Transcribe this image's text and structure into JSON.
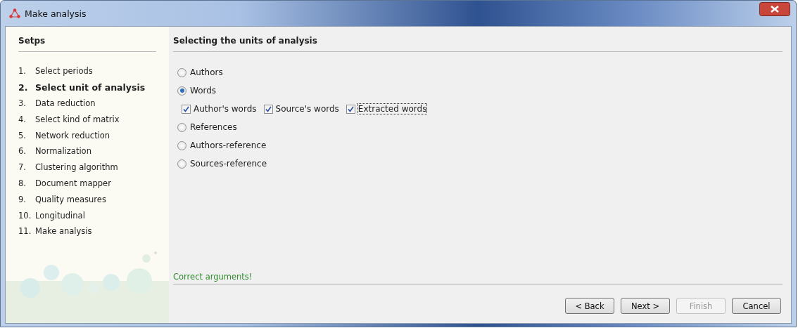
{
  "window": {
    "title": "Make analysis"
  },
  "steps": {
    "title": "Setps",
    "items": [
      {
        "number": "1.",
        "label": "Select periods",
        "selected": false
      },
      {
        "number": "2.",
        "label": "Select unit of analysis",
        "selected": true
      },
      {
        "number": "3.",
        "label": "Data reduction",
        "selected": false
      },
      {
        "number": "4.",
        "label": "Select kind of matrix",
        "selected": false
      },
      {
        "number": "5.",
        "label": "Network reduction",
        "selected": false
      },
      {
        "number": "6.",
        "label": "Normalization",
        "selected": false
      },
      {
        "number": "7.",
        "label": "Clustering algorithm",
        "selected": false
      },
      {
        "number": "8.",
        "label": "Document mapper",
        "selected": false
      },
      {
        "number": "9.",
        "label": "Quality measures",
        "selected": false
      },
      {
        "number": "10.",
        "label": "Longitudinal",
        "selected": false
      },
      {
        "number": "11.",
        "label": "Make analysis",
        "selected": false
      }
    ]
  },
  "panel": {
    "title": "Selecting the units of analysis",
    "options": [
      {
        "kind": "radio",
        "label": "Authors",
        "selected": false
      },
      {
        "kind": "radio",
        "label": "Words",
        "selected": true
      },
      {
        "kind": "checks",
        "items": [
          {
            "label": "Author's words",
            "checked": true,
            "focused": false
          },
          {
            "label": "Source's words",
            "checked": true,
            "focused": false
          },
          {
            "label": "Extracted words",
            "checked": true,
            "focused": true
          }
        ]
      },
      {
        "kind": "radio",
        "label": "References",
        "selected": false
      },
      {
        "kind": "radio",
        "label": "Authors-reference",
        "selected": false
      },
      {
        "kind": "radio",
        "label": "Sources-reference",
        "selected": false
      }
    ]
  },
  "status": "Correct arguments!",
  "buttons": [
    {
      "label": "< Back",
      "disabled": false
    },
    {
      "label": "Next >",
      "disabled": false
    },
    {
      "label": "Finish",
      "disabled": true
    },
    {
      "label": "Cancel",
      "disabled": false
    }
  ]
}
